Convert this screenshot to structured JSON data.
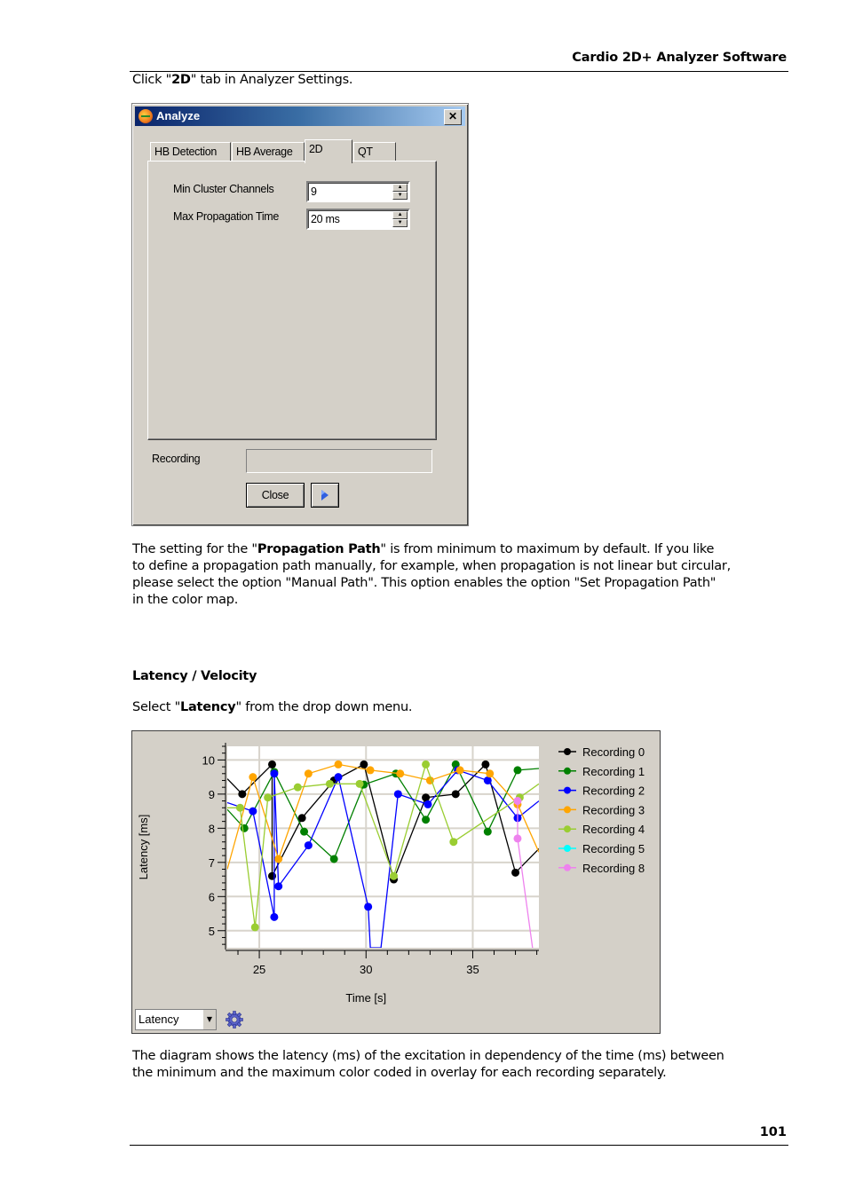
{
  "header": {
    "title": "Cardio 2D+ Analyzer Software"
  },
  "intro": {
    "pre": "Click \"",
    "bold": "2D",
    "post": "\" tab in Analyzer Settings."
  },
  "dialog": {
    "title": "Analyze",
    "close_label": "✕",
    "tabs": [
      {
        "label": "HB Detection",
        "selected": false
      },
      {
        "label": "HB Average",
        "selected": false
      },
      {
        "label": "2D",
        "selected": true
      },
      {
        "label": "QT",
        "selected": false
      }
    ],
    "fields": [
      {
        "label": "Min Cluster Channels",
        "value": "9"
      },
      {
        "label": "Max Propagation Time",
        "value": "20 ms"
      }
    ],
    "recording_label": "Recording",
    "recording_value": "",
    "close_button": "Close",
    "play_icon": "play-icon"
  },
  "para1": {
    "line1_pre": "The setting for the \"",
    "line1_bold": "Propagation Path",
    "line1_post": "\" is from minimum to maximum by default. If you like",
    "line2": "to define a propagation path manually, for example, when propagation is not linear but circular,",
    "line3": "please select the option \"Manual Path\". This option enables the option \"Set Propagation Path\"",
    "line4": "in the color map."
  },
  "section_heading": "Latency / Velocity",
  "select_text": {
    "pre": "Select \"",
    "bold": "Latency",
    "post": "\" from the drop down menu."
  },
  "chart_panel": {
    "dropdown_value": "Latency",
    "settings_icon": "gear-icon"
  },
  "chart_data": {
    "type": "line",
    "title": "",
    "xlabel": "Time [s]",
    "ylabel": "Latency [ms]",
    "xlim": [
      23.5,
      38.1
    ],
    "ylim": [
      4.5,
      10.4
    ],
    "xticks": [
      25,
      30,
      35
    ],
    "yticks": [
      5,
      6,
      7,
      8,
      9,
      10
    ],
    "grid": true,
    "legend_position": "right",
    "series": [
      {
        "name": "Recording 0",
        "color": "#000000",
        "points": [
          [
            23.5,
            9.45
          ],
          [
            24.2,
            9.0
          ],
          [
            25.6,
            9.87
          ],
          [
            25.6,
            6.6
          ],
          [
            27.0,
            8.3
          ],
          [
            28.5,
            9.4
          ],
          [
            29.9,
            9.87
          ],
          [
            31.3,
            6.5
          ],
          [
            32.8,
            8.9
          ],
          [
            34.2,
            9.0
          ],
          [
            35.6,
            9.87
          ],
          [
            37.0,
            6.7
          ],
          [
            38.1,
            7.4
          ]
        ]
      },
      {
        "name": "Recording 1",
        "color": "#008000",
        "points": [
          [
            23.5,
            8.55
          ],
          [
            24.3,
            8.0
          ],
          [
            25.7,
            9.65
          ],
          [
            27.1,
            7.9
          ],
          [
            28.5,
            7.1
          ],
          [
            29.9,
            9.28
          ],
          [
            31.4,
            9.6
          ],
          [
            32.8,
            8.25
          ],
          [
            34.2,
            9.87
          ],
          [
            35.7,
            7.9
          ],
          [
            37.1,
            9.7
          ],
          [
            38.1,
            9.75
          ]
        ]
      },
      {
        "name": "Recording 2",
        "color": "#0000ff",
        "points": [
          [
            23.5,
            8.75
          ],
          [
            24.7,
            8.5
          ],
          [
            25.7,
            5.4
          ],
          [
            25.7,
            9.6
          ],
          [
            25.9,
            6.3
          ],
          [
            27.3,
            7.5
          ],
          [
            28.7,
            9.5
          ],
          [
            30.1,
            5.7
          ],
          [
            30.2,
            4.5
          ],
          [
            30.7,
            4.5
          ],
          [
            31.5,
            9.0
          ],
          [
            32.9,
            8.7
          ],
          [
            34.3,
            9.7
          ],
          [
            35.7,
            9.4
          ],
          [
            37.1,
            8.3
          ],
          [
            38.1,
            8.8
          ]
        ]
      },
      {
        "name": "Recording 3",
        "color": "#ffa500",
        "points": [
          [
            23.5,
            6.8
          ],
          [
            24.7,
            9.5
          ],
          [
            25.9,
            7.1
          ],
          [
            27.3,
            9.6
          ],
          [
            28.7,
            9.87
          ],
          [
            30.2,
            9.7
          ],
          [
            31.6,
            9.6
          ],
          [
            33.0,
            9.4
          ],
          [
            34.4,
            9.7
          ],
          [
            35.8,
            9.6
          ],
          [
            37.1,
            8.7
          ],
          [
            38.1,
            7.3
          ]
        ]
      },
      {
        "name": "Recording 4",
        "color": "#9acd32",
        "points": [
          [
            23.5,
            8.6
          ],
          [
            24.1,
            8.6
          ],
          [
            24.8,
            5.1
          ],
          [
            25.4,
            8.9
          ],
          [
            26.8,
            9.2
          ],
          [
            28.3,
            9.3
          ],
          [
            29.7,
            9.3
          ],
          [
            31.3,
            6.6
          ],
          [
            32.8,
            9.87
          ],
          [
            34.1,
            7.6
          ],
          [
            37.2,
            8.9
          ],
          [
            38.1,
            9.3
          ]
        ]
      },
      {
        "name": "Recording 5",
        "color": "#00ffff",
        "points": []
      },
      {
        "name": "Recording 8",
        "color": "#ee82ee",
        "points": [
          [
            37.1,
            8.8
          ],
          [
            37.1,
            7.7
          ],
          [
            37.8,
            4.5
          ]
        ]
      }
    ]
  },
  "para2": {
    "line1": "The diagram shows the latency (ms) of the excitation in dependency of the time (ms) between",
    "line2": "the minimum and the maximum color coded in overlay for each recording separately."
  },
  "footer": {
    "page_number": "101"
  }
}
